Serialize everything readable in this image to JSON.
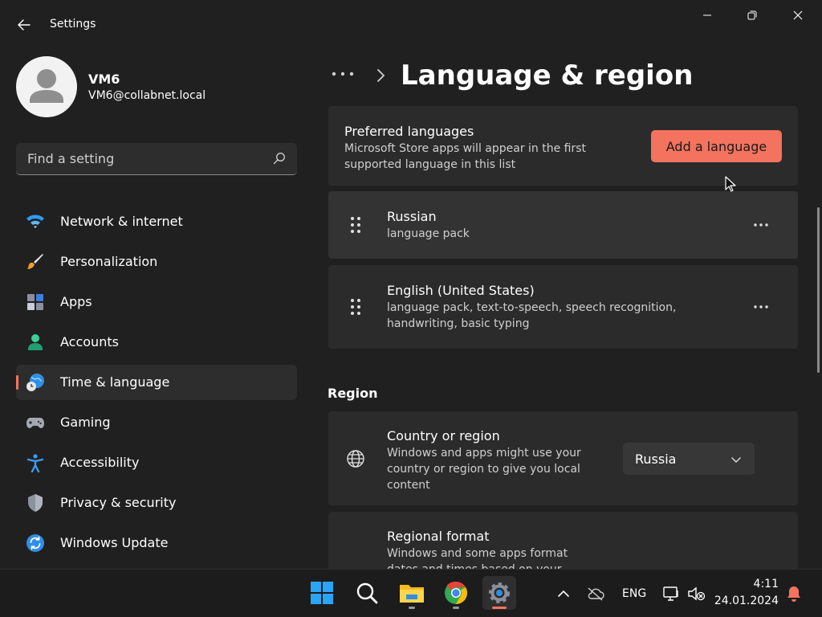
{
  "window": {
    "title": "Settings"
  },
  "user": {
    "name": "VM6",
    "email": "VM6@collabnet.local"
  },
  "search": {
    "placeholder": "Find a setting"
  },
  "sidebar": {
    "items": [
      {
        "label": "Network & internet",
        "icon": "wifi-icon"
      },
      {
        "label": "Personalization",
        "icon": "brush-icon"
      },
      {
        "label": "Apps",
        "icon": "apps-icon"
      },
      {
        "label": "Accounts",
        "icon": "person-icon"
      },
      {
        "label": "Time & language",
        "icon": "globe-clock-icon",
        "active": true
      },
      {
        "label": "Gaming",
        "icon": "gamepad-icon"
      },
      {
        "label": "Accessibility",
        "icon": "accessibility-icon"
      },
      {
        "label": "Privacy & security",
        "icon": "shield-icon"
      },
      {
        "label": "Windows Update",
        "icon": "update-icon"
      }
    ]
  },
  "header": {
    "breadcrumb_more": "•••",
    "title": "Language & region"
  },
  "preferred": {
    "title": "Preferred languages",
    "desc_line1": "Microsoft Store apps will appear in the first",
    "desc_line2": "supported language in this list",
    "add_label": "Add a language"
  },
  "languages": [
    {
      "name": "Russian",
      "detail_line1": "language pack",
      "detail_line2": ""
    },
    {
      "name": "English (United States)",
      "detail_line1": "language pack, text-to-speech, speech recognition,",
      "detail_line2": "handwriting, basic typing"
    }
  ],
  "region": {
    "heading": "Region",
    "country_title": "Country or region",
    "country_desc_line1": "Windows and apps might use your",
    "country_desc_line2": "country or region to give you local",
    "country_desc_line3": "content",
    "country_value": "Russia",
    "format_title": "Regional format",
    "format_desc_line1": "Windows and some apps format",
    "format_desc_line2": "dates and times based on your"
  },
  "taskbar": {
    "apps": [
      "windows-start-icon",
      "search-icon",
      "file-explorer-icon",
      "chrome-icon",
      "settings-icon"
    ],
    "lang": "ENG",
    "time": "4:11",
    "date": "24.01.2024"
  },
  "colors": {
    "accent": "#f4735e",
    "background": "#202020",
    "card": "#2b2b2b"
  }
}
